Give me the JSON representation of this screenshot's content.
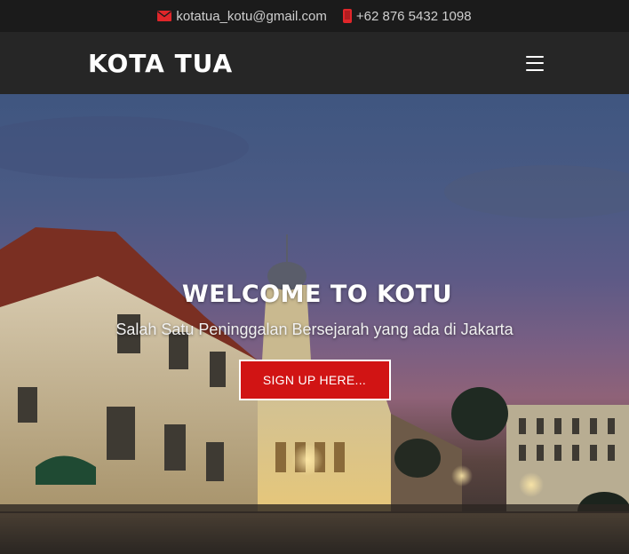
{
  "topbar": {
    "email": "kotatua_kotu@gmail.com",
    "email_icon": "envelope-icon",
    "phone": "+62 876 5432 1098",
    "phone_icon": "mobile-phone-icon"
  },
  "navbar": {
    "brand": "KOTA TUA",
    "menu_icon": "hamburger-menu-icon"
  },
  "hero": {
    "title": "WELCOME TO KOTU",
    "subtitle": "Salah Satu Peninggalan Bersejarah yang ada di Jakarta",
    "cta_label": "SIGN UP HERE..."
  },
  "colors": {
    "topbar_bg": "#1b1b1b",
    "navbar_bg": "#262626",
    "accent": "#d11414",
    "text": "#ffffff"
  }
}
